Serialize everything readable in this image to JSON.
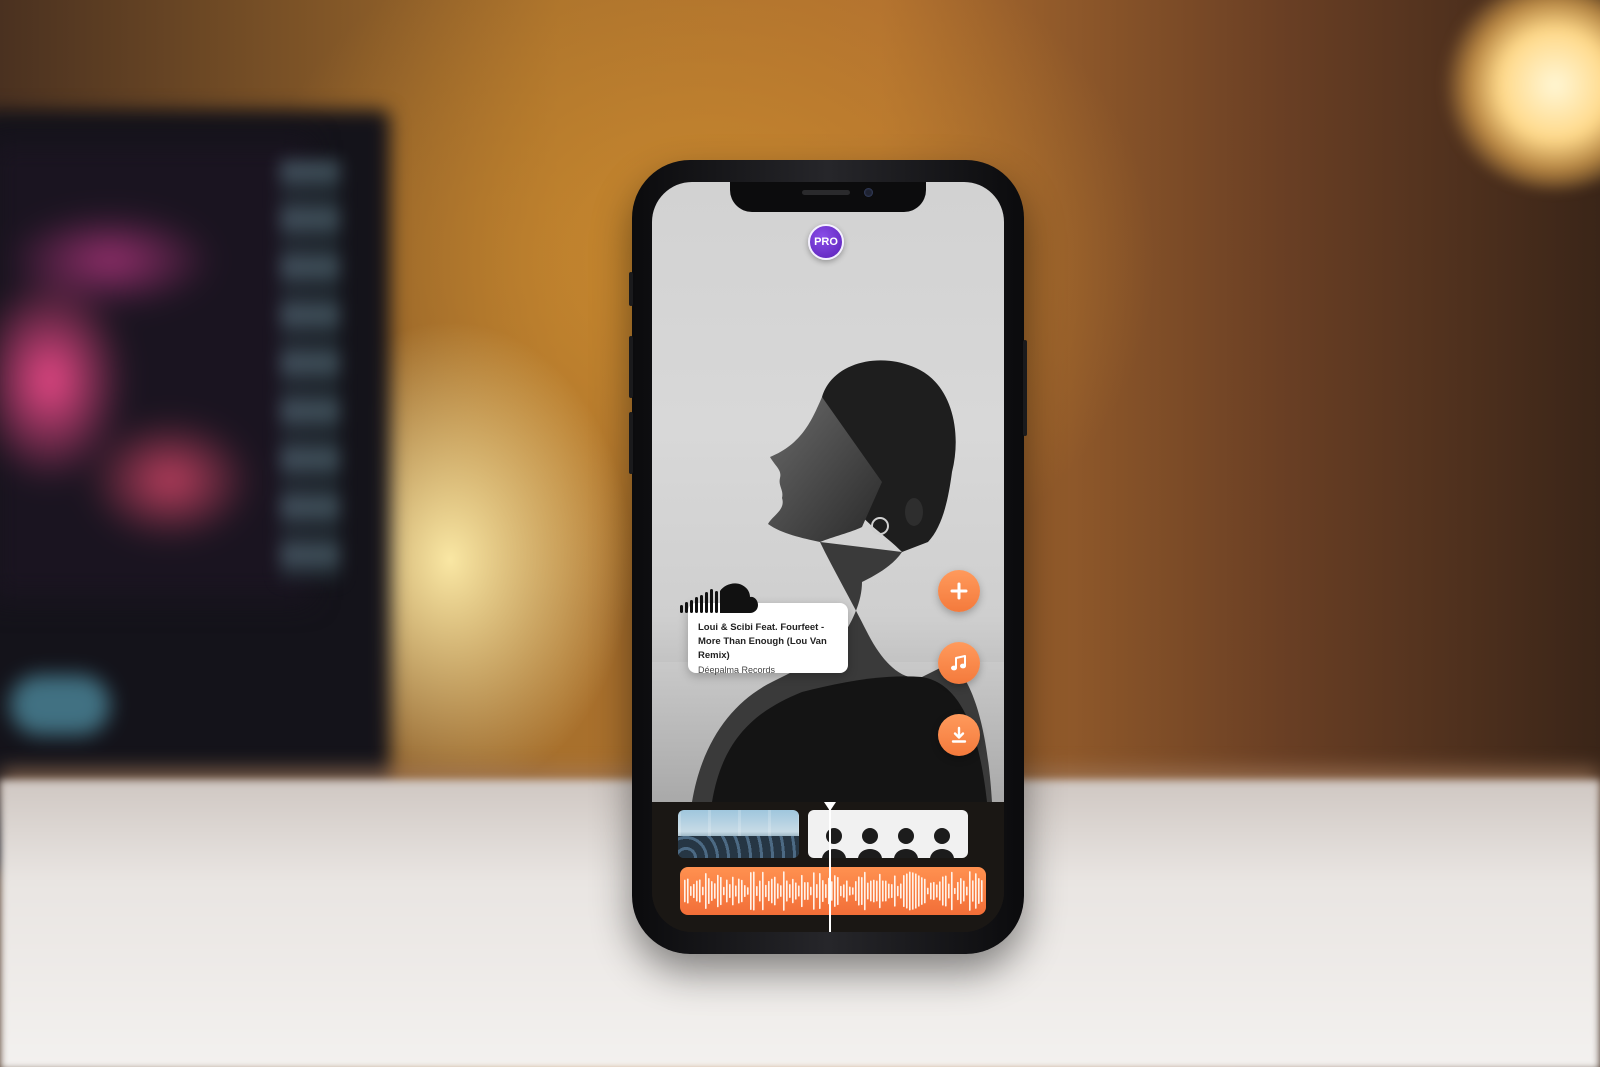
{
  "badge": {
    "label": "PRO"
  },
  "actions": [
    {
      "name": "add",
      "icon": "plus-icon"
    },
    {
      "name": "music",
      "icon": "music-note-icon"
    },
    {
      "name": "download",
      "icon": "download-icon"
    }
  ],
  "track": {
    "source_icon": "soundcloud-icon",
    "title": "Loui & Scibi Feat. Fourfeet - More Than Enough (Lou Van Remix)",
    "label": "Déepalma Records"
  },
  "timeline": {
    "clips": [
      "concert-crowd-clip",
      "silhouettes-clip"
    ],
    "playhead_fraction": 0.5
  },
  "colors": {
    "accent": "#f47a3c",
    "pro": "#6a2fd0",
    "waveform": "#f26e38"
  }
}
